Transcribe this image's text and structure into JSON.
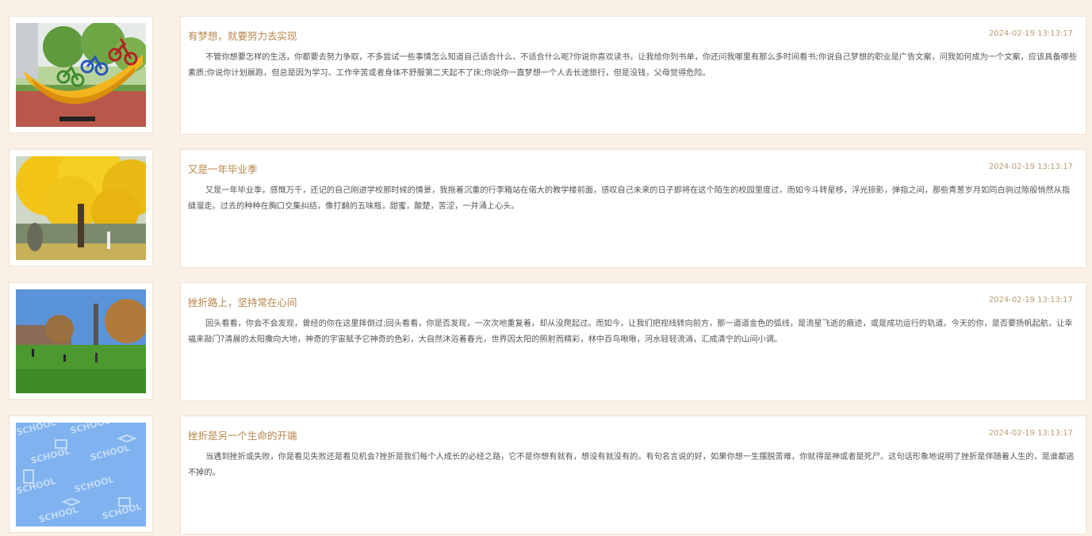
{
  "posts": [
    {
      "title": "有梦想，就要努力去实现",
      "date": "2024-02-19 13:13:17",
      "body": "不管你想要怎样的生活，你都要去努力争取，不多尝试一些事情怎么知道自己适合什么、不适合什么呢?你说你喜欢读书，让我给你列书单，你还问我哪里有那么多时间看书;你说自己梦想的职业是广告文案，问我如何成为一个文案，应该具备哪些素质;你说你计划晨跑，但总是因为学习、工作辛苦或者身体不舒服第二天起不了床;你说你一直梦想一个人去长途旅行，但是没钱，父母觉得危险。",
      "image": "cyclist-sculpture"
    },
    {
      "title": "又是一年毕业季",
      "date": "2024-02-19 13:13:17",
      "body": "又是一年毕业季，感慨万千，还记的自己刚进学校那时候的情景，我拖着沉重的行李箱站在偌大的教学楼前面，感叹自己未来的日子即将在这个陌生的校园里度过，而如今斗转星移，浮光掠影，弹指之间，那些青葱岁月如同白驹过隙般悄然从指缝溜走。过去的种种在胸口交集纠结，像打翻的五味瓶，甜蜜，酸楚，苦涩，一并涌上心头。",
      "image": "yellow-tree"
    },
    {
      "title": "挫折路上，坚持常在心间",
      "date": "2024-02-19 13:13:17",
      "body": "回头看看，你会不会发现，曾经的你在这里摔倒过;回头看看，你是否发现，一次次地重复着，却从没爬起过。而如今，让我们把视线转向前方，那一道道金色的弧线，是流星飞逝的痕迹，或是成功运行的轨道。今天的你，是否要扬帆起航，让幸福来敲门?清晨的太阳撒向大地，神奇的宇宙赋予它神奇的色彩，大自然沐浴着春光，世界因太阳的照射而精彩，林中百鸟啾啾，河水轻轻流淌，汇成清宁的山间小调。",
      "image": "campus-lawn"
    },
    {
      "title": "挫折是另一个生命的开端",
      "date": "2024-02-19 13:13:17",
      "body": "当遇到挫折或失败，你是看见失败还是看见机会?挫折是我们每个人成长的必经之路，它不是你想有就有，想没有就没有的。有句名言说的好，如果你想一生摆脱苦难，你就得是神或者是死尸。这句话形象地说明了挫折是伴随着人生的，是谁都逃不掉的。",
      "image": "school-pattern",
      "pattern_word": "SCHOOL"
    }
  ]
}
